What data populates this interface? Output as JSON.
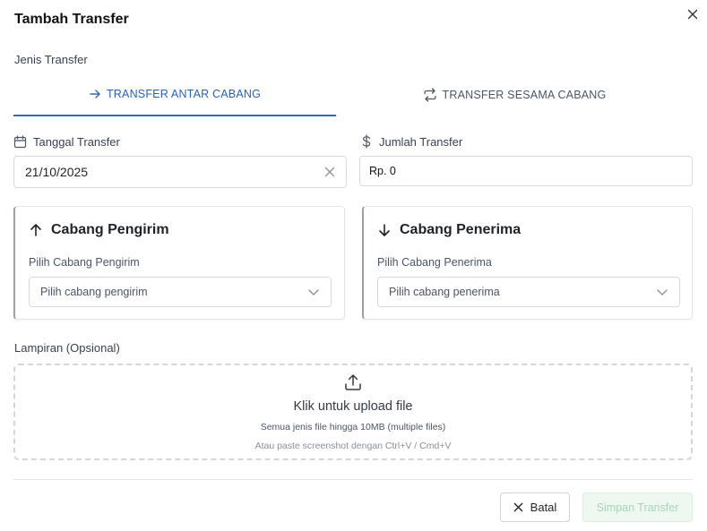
{
  "dialog": {
    "title": "Tambah Transfer"
  },
  "transfer_type": {
    "label": "Jenis Transfer",
    "tabs": [
      {
        "label": "TRANSFER ANTAR CABANG",
        "icon": "arrow-right-icon",
        "active": true
      },
      {
        "label": "TRANSFER SESAMA CABANG",
        "icon": "repeat-icon",
        "active": false
      }
    ]
  },
  "date_field": {
    "label": "Tanggal Transfer",
    "icon": "calendar-icon",
    "value": "21/10/2025"
  },
  "amount_field": {
    "label": "Jumlah Transfer",
    "icon": "dollar-icon",
    "value": "Rp. 0"
  },
  "sender": {
    "title": "Cabang Pengirim",
    "icon": "arrow-up-icon",
    "select_label": "Pilih Cabang Pengirim",
    "placeholder": "Pilih cabang pengirim"
  },
  "receiver": {
    "title": "Cabang Penerima",
    "icon": "arrow-down-icon",
    "select_label": "Pilih Cabang Penerima",
    "placeholder": "Pilih cabang penerima"
  },
  "attachment": {
    "label": "Lampiran (Opsional)",
    "icon": "upload-icon",
    "title": "Klik untuk upload file",
    "subtitle": "Semua jenis file hingga 10MB (multiple files)",
    "hint": "Atau paste screenshot dengan Ctrl+V / Cmd+V"
  },
  "footer": {
    "cancel_label": "Batal",
    "save_label": "Simpan Transfer"
  },
  "colors": {
    "accent": "#2f6bb5",
    "save_bg": "#eef8f1",
    "save_text": "#a8d3b4"
  }
}
